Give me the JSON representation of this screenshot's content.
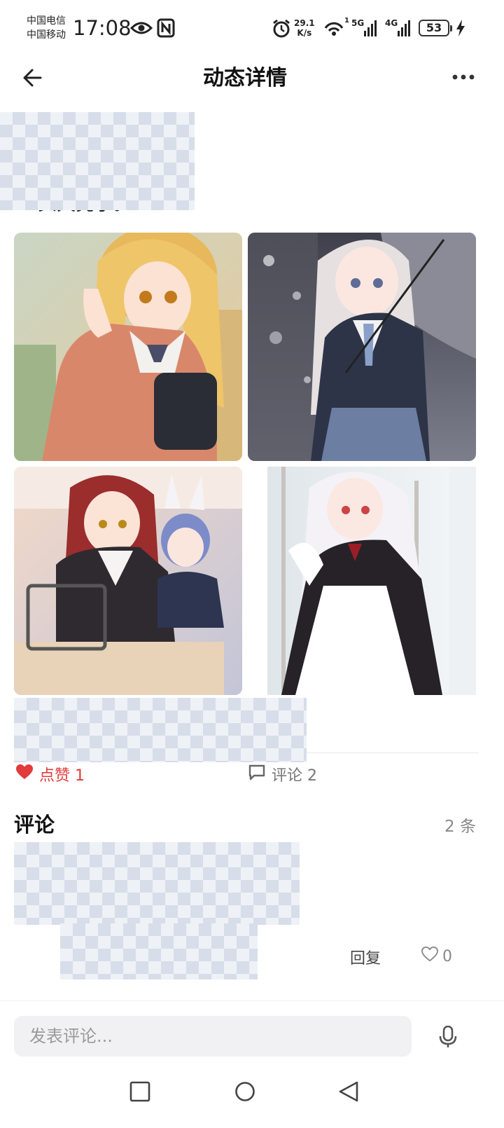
{
  "status_bar": {
    "carrier_1": "中国电信",
    "carrier_2": "中国移动",
    "time": "17:08",
    "net_speed_value": "29.1",
    "net_speed_unit": "K/s",
    "wifi_sup": "1",
    "sig1_label": "5G",
    "sig2_label": "4G",
    "battery": "53",
    "icons": [
      "eye-icon",
      "nfc-icon",
      "alarm-icon",
      "wifi-icon",
      "signal-icon",
      "battery-icon",
      "charging-icon"
    ]
  },
  "header": {
    "title": "动态详情",
    "back_icon": "back-arrow-icon",
    "more_icon": "more-dots-icon"
  },
  "post": {
    "text": "……头天亮了。",
    "images": [
      {
        "name": "post-image-1",
        "desc": "girl-orange-cardigan"
      },
      {
        "name": "post-image-2",
        "desc": "girl-umbrella"
      },
      {
        "name": "post-image-3",
        "desc": "girls-classroom"
      },
      {
        "name": "post-image-4",
        "desc": "maid-girl"
      }
    ]
  },
  "actions": {
    "like_label": "点赞 1",
    "comment_label": "评论 2",
    "like_color": "#e13b3b"
  },
  "comments": {
    "title": "评论",
    "count_label": "2 条",
    "reply_label": "回复",
    "like_count": "0"
  },
  "input": {
    "placeholder": "发表评论..."
  }
}
